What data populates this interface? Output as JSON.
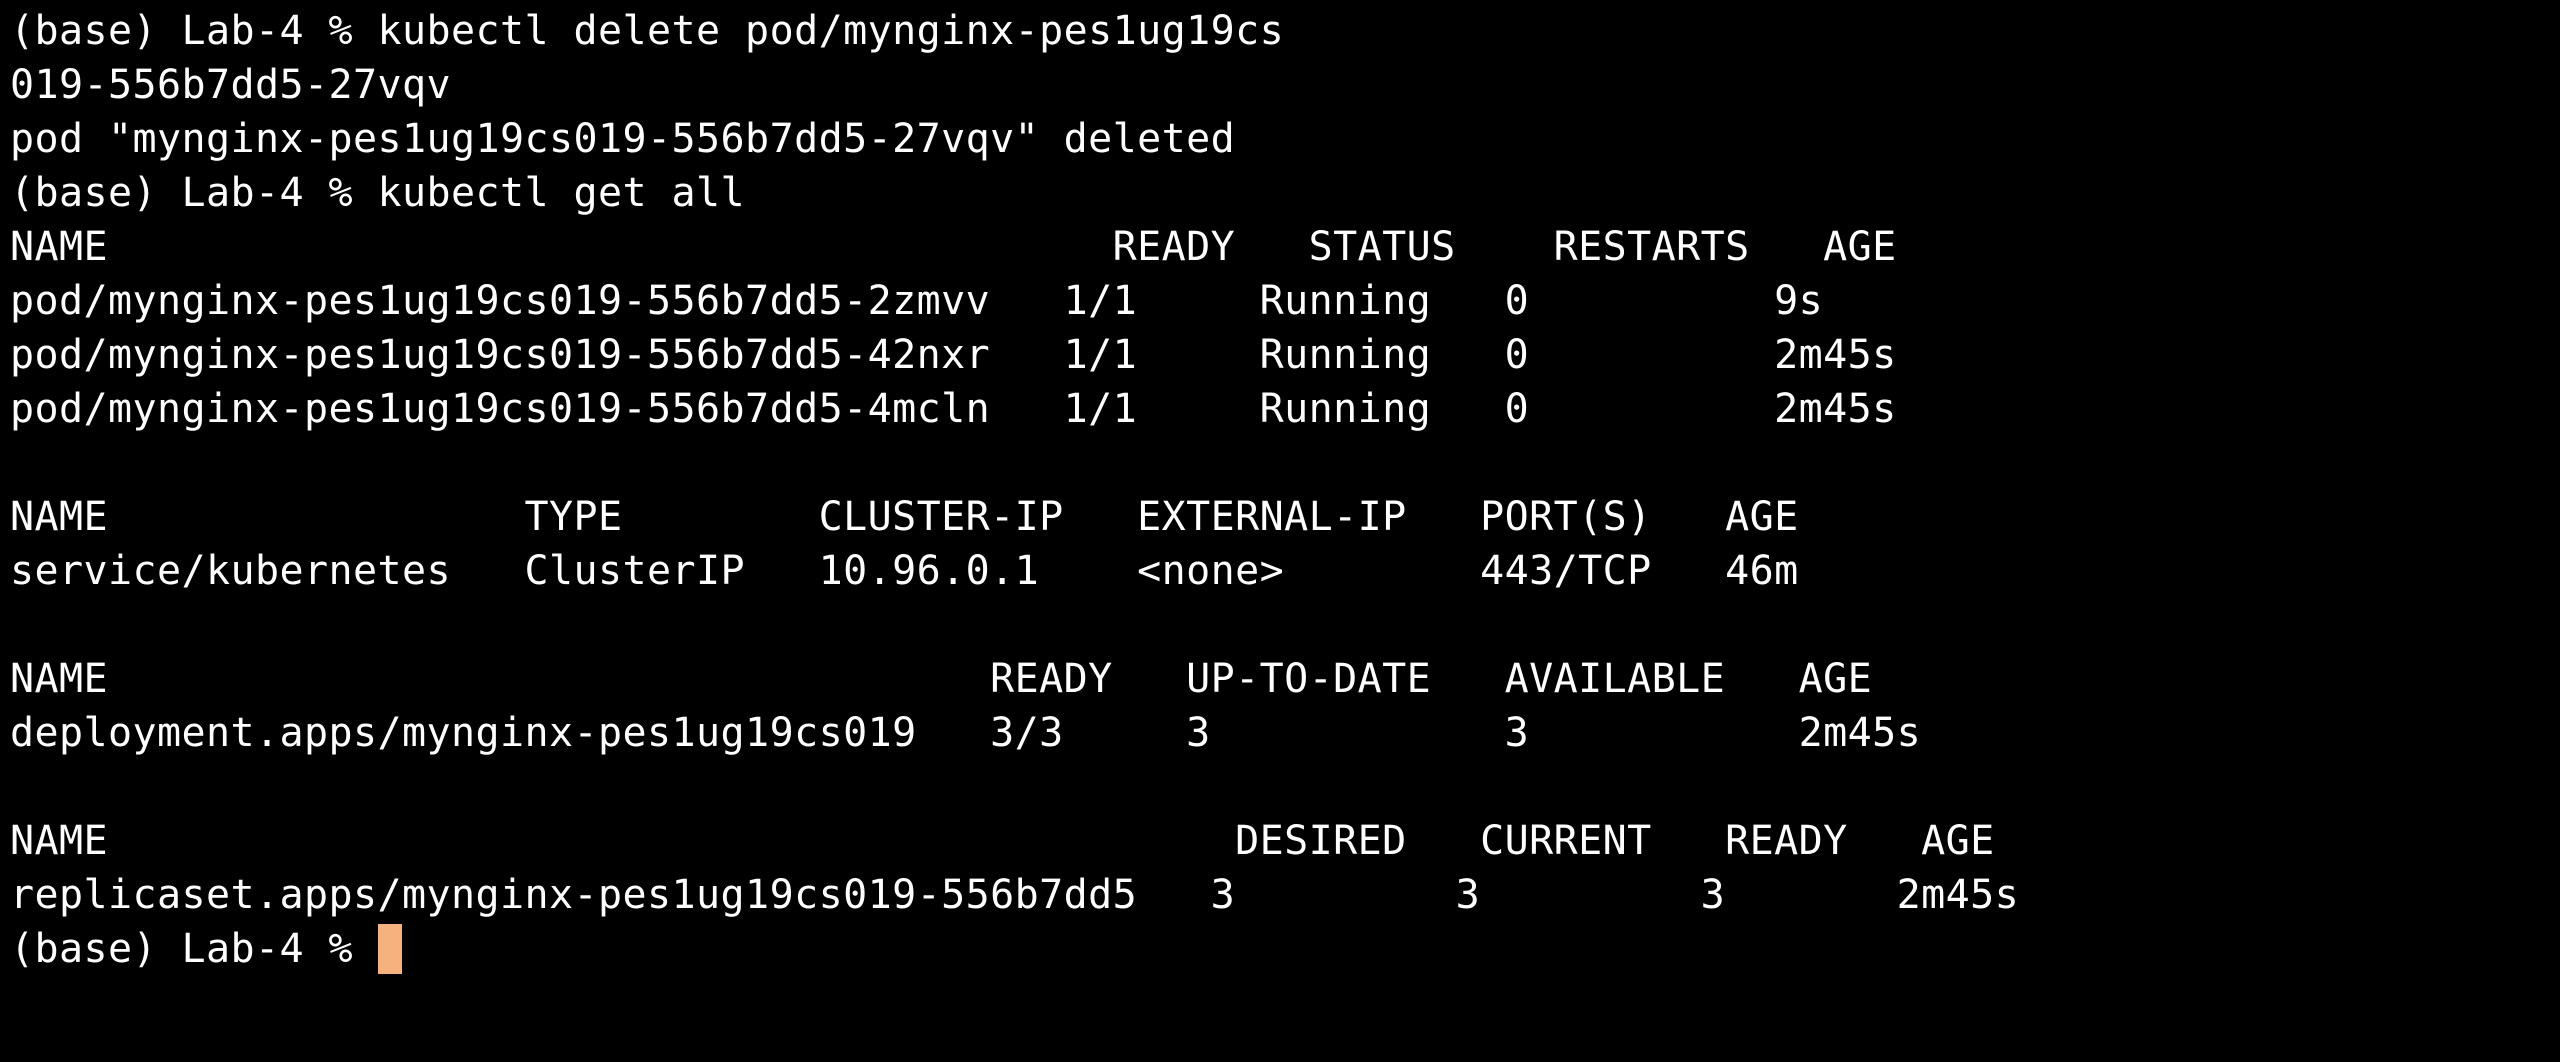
{
  "terminal": {
    "prompt": "(base) Lab-4 % ",
    "cursor_color": "#f5b27f",
    "lines": {
      "l1": "(base) Lab-4 % kubectl delete pod/mynginx-pes1ug19cs",
      "l2": "019-556b7dd5-27vqv",
      "l3": "pod \"mynginx-pes1ug19cs019-556b7dd5-27vqv\" deleted",
      "l4": "(base) Lab-4 % kubectl get all"
    },
    "pods": {
      "header": "NAME                                         READY   STATUS    RESTARTS   AGE",
      "rows": [
        "pod/mynginx-pes1ug19cs019-556b7dd5-2zmvv   1/1     Running   0          9s",
        "pod/mynginx-pes1ug19cs019-556b7dd5-42nxr   1/1     Running   0          2m45s",
        "pod/mynginx-pes1ug19cs019-556b7dd5-4mcln   1/1     Running   0          2m45s"
      ]
    },
    "services": {
      "header": "NAME                 TYPE        CLUSTER-IP   EXTERNAL-IP   PORT(S)   AGE",
      "rows": [
        "service/kubernetes   ClusterIP   10.96.0.1    <none>        443/TCP   46m"
      ]
    },
    "deployments": {
      "header": "NAME                                    READY   UP-TO-DATE   AVAILABLE   AGE",
      "rows": [
        "deployment.apps/mynginx-pes1ug19cs019   3/3     3            3           2m45s"
      ]
    },
    "replicasets": {
      "header": "NAME                                              DESIRED   CURRENT   READY   AGE",
      "rows": [
        "replicaset.apps/mynginx-pes1ug19cs019-556b7dd5   3         3         3       2m45s"
      ]
    }
  }
}
